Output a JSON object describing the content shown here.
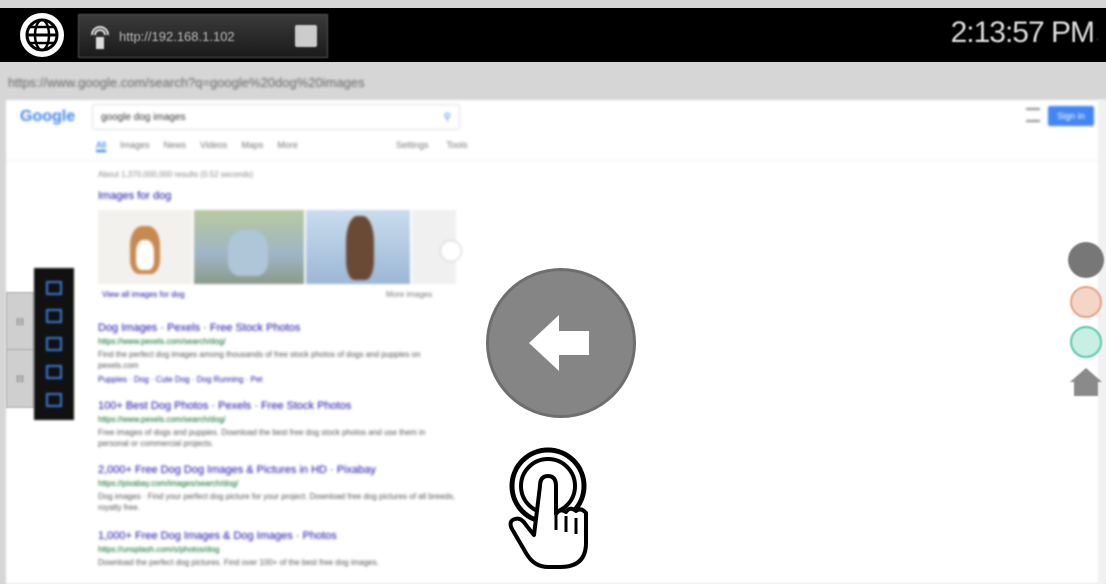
{
  "header": {
    "cast_url": "http://192.168.1.102",
    "clock_time": "2:13:57 PM",
    "clock_suffix": "·"
  },
  "address_bar": {
    "url": "https://www.google.com/search?q=google%20dog%20images"
  },
  "google": {
    "logo": "Google",
    "query": "google dog images",
    "signin_label": "Sign in",
    "tabs": [
      "All",
      "Images",
      "News",
      "Videos",
      "Maps",
      "More"
    ],
    "tools": [
      "Settings",
      "Tools"
    ],
    "stats": "About 1,370,000,000 results (0.52 seconds)",
    "images_heading": "Images for dog",
    "images_footer": "View all images for dog",
    "images_more": "More images",
    "results": [
      {
        "title": "Dog Images · Pexels · Free Stock Photos",
        "url": "https://www.pexels.com/search/dog/",
        "snippet": "Find the perfect dog images among thousands of free stock photos of dogs and puppies on pexels.com",
        "links": "Puppies · Dog · Cute Dog · Dog Running · Pet"
      },
      {
        "title": "100+ Best Dog Photos · Pexels · Free Stock Photos",
        "url": "https://www.pexels.com/search/dog/",
        "snippet": "Free images of dogs and puppies. Download the best free dog stock photos and use them in personal or commercial projects."
      },
      {
        "title": "2,000+ Free Dog Dog Images & Pictures in HD · Pixabay",
        "url": "https://pixabay.com/images/search/dog/",
        "snippet": "Dog images · Find your perfect dog picture for your project. Download free dog pictures of all breeds, royalty free."
      },
      {
        "title": "1,000+ Free Dog Images & Dog Images · Photos",
        "url": "https://unsplash.com/s/photos/dog",
        "snippet": "Download the perfect dog pictures. Find over 100+ of the best free dog images."
      }
    ]
  },
  "colors": {
    "header_bg": "#000000",
    "back_button": "#858585",
    "google_blue": "#4285f4",
    "link_blue": "#1a0dab",
    "url_green": "#006621"
  },
  "icons": {
    "globe": "globe-icon",
    "cast": "cast-icon",
    "qr": "grid-icon",
    "back": "arrow-left-icon",
    "hand": "hand-tap-icon",
    "home": "home-icon"
  }
}
